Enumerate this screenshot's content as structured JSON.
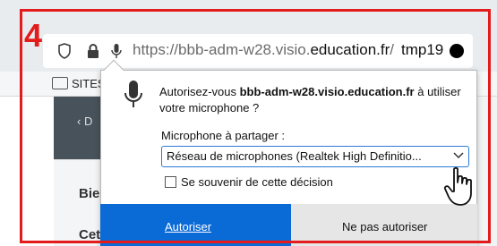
{
  "step_number": "4",
  "url": {
    "prefix": "https://",
    "host": "bbb-adm-w28.visio.",
    "domain": "education.fr",
    "suffix": "/",
    "tab_label": "tmp19"
  },
  "bookmarks": {
    "folder_label": "SITES"
  },
  "page": {
    "back_link": "‹ D",
    "heading1": "Bie",
    "heading2": "Cet"
  },
  "popup": {
    "question_prefix": "Autorisez-vous ",
    "question_domain": "bbb-adm-w28.visio.education.fr",
    "question_suffix": " à utiliser votre microphone ?",
    "share_label": "Microphone à partager :",
    "selected_device": "Réseau de microphones (Realtek High Definitio...",
    "remember_label": "Se souvenir de cette décision",
    "allow_button": "Autoriser",
    "deny_button": "Ne pas autoriser"
  },
  "colors": {
    "frame": "#e31b1b",
    "allow": "#0a6ad6"
  },
  "icons": [
    "shield-icon",
    "lock-icon",
    "microphone-icon",
    "folder-icon",
    "chevron-down-icon",
    "hand-cursor-icon"
  ]
}
